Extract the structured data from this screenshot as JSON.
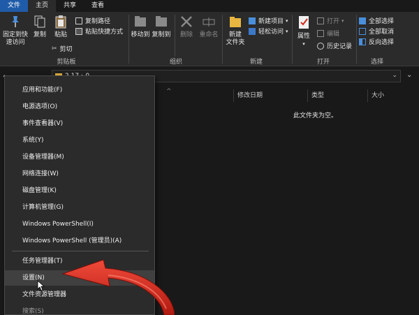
{
  "ribbon_tabs": {
    "file": "文件",
    "home": "主页",
    "share": "共享",
    "view": "查看"
  },
  "clipboard": {
    "pin": "固定到快\n速访问",
    "copy": "复制",
    "paste": "粘贴",
    "copy_path": "复制路径",
    "paste_shortcut": "粘贴快捷方式",
    "cut": "剪切",
    "label": "剪贴板"
  },
  "organize": {
    "move_to": "移动到",
    "copy_to": "复制到",
    "delete": "删除",
    "rename": "重命名",
    "label": "组织"
  },
  "new_group": {
    "new_folder": "新建\n文件夹",
    "new_item": "新建项目",
    "easy_access": "轻松访问",
    "label": "新建"
  },
  "open_group": {
    "properties": "属性",
    "open": "打开",
    "edit": "编辑",
    "history": "历史记录",
    "label": "打开"
  },
  "select_group": {
    "select_all": "全部选择",
    "select_none": "全部取消",
    "invert": "反向选择",
    "label": "选择"
  },
  "address": {
    "path": "2.17 › 0"
  },
  "columns": {
    "modified": "修改日期",
    "type": "类型",
    "size": "大小"
  },
  "empty_message": "此文件夹为空。",
  "menu": {
    "items": [
      "应用和功能(F)",
      "电源选项(O)",
      "事件查看器(V)",
      "系统(Y)",
      "设备管理器(M)",
      "网络连接(W)",
      "磁盘管理(K)",
      "计算机管理(G)",
      "Windows PowerShell(I)",
      "Windows PowerShell (管理员)(A)",
      "任务管理器(T)",
      "设置(N)",
      "文件资源管理器",
      "搜索(S)"
    ]
  },
  "colors": {
    "file_tab": "#1f5ba8",
    "arrow": "#d32a1c",
    "background": "#191919"
  }
}
